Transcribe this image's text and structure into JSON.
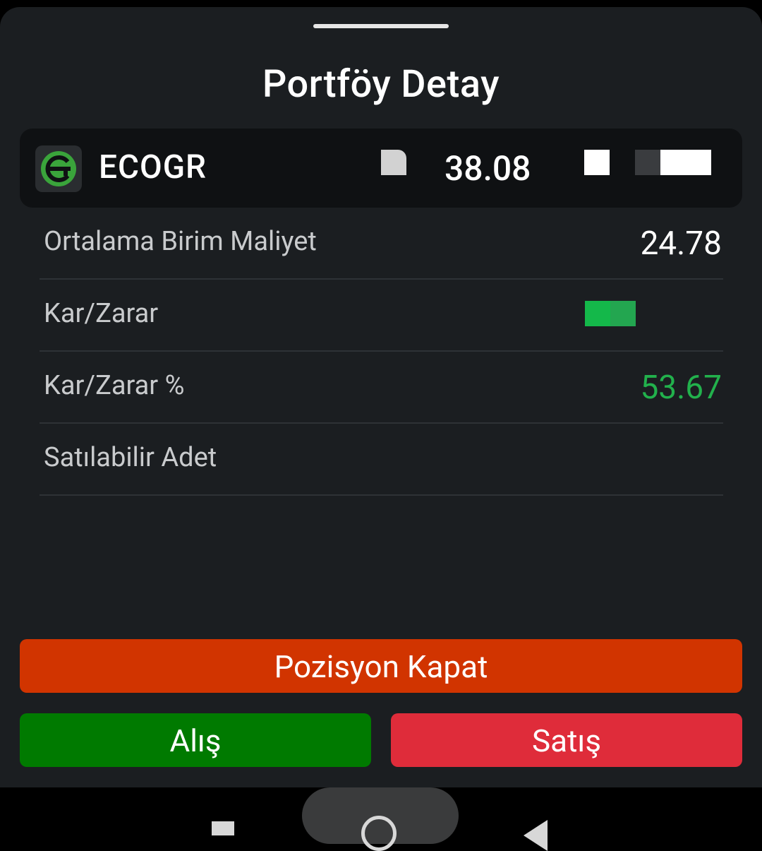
{
  "sheet": {
    "title": "Portföy Detay"
  },
  "stock": {
    "symbol": "ECOGR",
    "price": "38.08",
    "logo_icon": "ecogr-logo-icon",
    "logo_color": "#3aa43b"
  },
  "details": [
    {
      "label": "Ortalama Birim Maliyet",
      "value": "24.78"
    },
    {
      "label": "Kar/Zarar",
      "value": ""
    },
    {
      "label": "Kar/Zarar %",
      "value": "53.67"
    },
    {
      "label": "Satılabilir Adet",
      "value": ""
    }
  ],
  "actions": {
    "close_position": "Pozisyon Kapat",
    "buy": "Alış",
    "sell": "Satış"
  },
  "colors": {
    "close_position": "#d13400",
    "buy": "#007a00",
    "sell": "#df2c3a",
    "profit": "#22b14c"
  },
  "navbar": {
    "icons": [
      "recent-apps-icon",
      "home-icon",
      "back-icon"
    ]
  }
}
